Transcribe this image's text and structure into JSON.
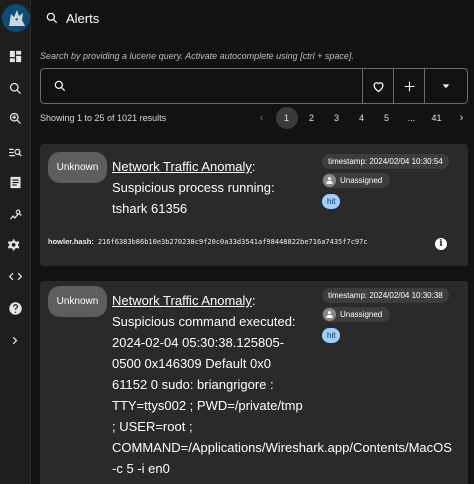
{
  "header": {
    "title": "Alerts"
  },
  "search": {
    "hint": "Search by providing a lucene query. Activate autocomplete using [ctrl + space].",
    "value": "",
    "placeholder": ""
  },
  "results_text": "Showing 1 to 25 of 1021 results",
  "pagination": {
    "pages": [
      "1",
      "2",
      "3",
      "4",
      "5",
      "...",
      "41"
    ],
    "current": "1"
  },
  "alerts": [
    {
      "status": "Unknown",
      "analytic": "Network Traffic Anomaly",
      "separator": ":",
      "lines": [
        "Suspicious process running:",
        "tshark 61356"
      ],
      "timestamp": "timestamp: 2024/02/04 10:30:54",
      "assignee": "Unassigned",
      "tag": "hit",
      "hash_label": "howler.hash:",
      "hash_value": "216f6383b86b10e3b270238c9f20c0a33d3541af98448822be716a7435f7c97c"
    },
    {
      "status": "Unknown",
      "analytic": "Network Traffic Anomaly",
      "separator": ":",
      "lines": [
        "Suspicious command executed:",
        "2024-02-04 05:30:38.125805-",
        "0500 0x146309 Default 0x0",
        "61152 0 sudo: briangrigore :",
        "TTY=ttys002 ; PWD=/private/tmp",
        "; USER=root ;",
        "COMMAND=/Applications/Wireshark.app/Contents/MacOS",
        "-c 5 -i en0"
      ],
      "timestamp": "timestamp: 2024/02/04 10:30:38",
      "assignee": "Unassigned",
      "tag": "hit"
    }
  ],
  "colors": {
    "background": "#121212",
    "card": "#2a2a2a",
    "hit_chip": "#9ed0ff",
    "status_pill": "#5e5e5e"
  }
}
